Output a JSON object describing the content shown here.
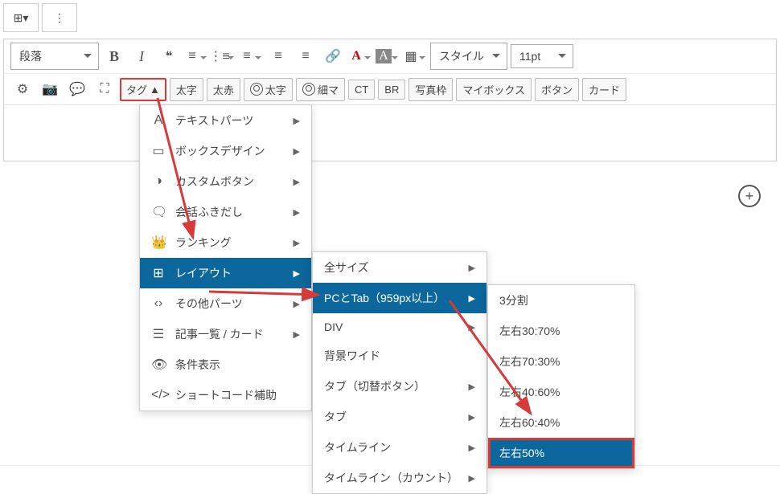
{
  "topbar": {
    "grid_icon": "⊞",
    "menu_icon": "⋮"
  },
  "toolbar": {
    "paragraph": "段落",
    "style": "スタイル",
    "fontsize": "11pt",
    "bold": "B",
    "italic": "I",
    "quote": "❝",
    "row2": {
      "tag": "タグ",
      "futoji1": "太字",
      "akaji": "太赤",
      "futoji2": "太字",
      "hosoma": "細マ",
      "ct": "CT",
      "br": "BR",
      "photoframe": "写真枠",
      "mybox": "マイボックス",
      "button": "ボタン",
      "card": "カード"
    }
  },
  "glyph": {
    "gear": "⚙",
    "camera": "📷",
    "speech": "💬",
    "expand": "⛶",
    "list_ul": "≡",
    "list_ol": "⋮≡",
    "align_l": "≡",
    "align_c": "≡",
    "align_r": "≡",
    "link": "🔗",
    "table": "▦",
    "dots": "⋮",
    "plus": "+",
    "tri_up": "▲"
  },
  "menu1": {
    "items": [
      {
        "icon": "A",
        "label": "テキストパーツ",
        "has_sub": true
      },
      {
        "icon": "▭",
        "label": "ボックスデザイン",
        "has_sub": true
      },
      {
        "icon": "◑",
        "label": "カスタムボタン",
        "has_sub": true
      },
      {
        "icon": "🗨",
        "label": "会話ふきだし",
        "has_sub": true
      },
      {
        "icon": "👑",
        "label": "ランキング",
        "has_sub": true
      },
      {
        "icon": "⊞",
        "label": "レイアウト",
        "has_sub": true,
        "selected": true
      },
      {
        "icon": "‹›",
        "label": "その他パーツ",
        "has_sub": true
      },
      {
        "icon": "☰",
        "label": "記事一覧 / カード",
        "has_sub": true
      },
      {
        "icon": "👁",
        "label": "条件表示"
      },
      {
        "icon": "</>",
        "label": "ショートコード補助"
      }
    ]
  },
  "menu2": {
    "items": [
      {
        "label": "全サイズ",
        "has_sub": true
      },
      {
        "label": "PCとTab（959px以上）",
        "has_sub": true,
        "selected": true
      },
      {
        "label": "DIV",
        "has_sub": true
      },
      {
        "label": "背景ワイド"
      },
      {
        "label": "タブ（切替ボタン）",
        "has_sub": true
      },
      {
        "label": "タブ",
        "has_sub": true
      },
      {
        "label": "タイムライン",
        "has_sub": true
      },
      {
        "label": "タイムライン（カウント）",
        "has_sub": true
      }
    ]
  },
  "menu3": {
    "items": [
      {
        "label": "3分割"
      },
      {
        "label": "左右30:70%"
      },
      {
        "label": "左右70:30%"
      },
      {
        "label": "左右40:60%"
      },
      {
        "label": "左右60:40%"
      },
      {
        "label": "左右50%",
        "selected": true,
        "highlighted": true
      }
    ]
  }
}
